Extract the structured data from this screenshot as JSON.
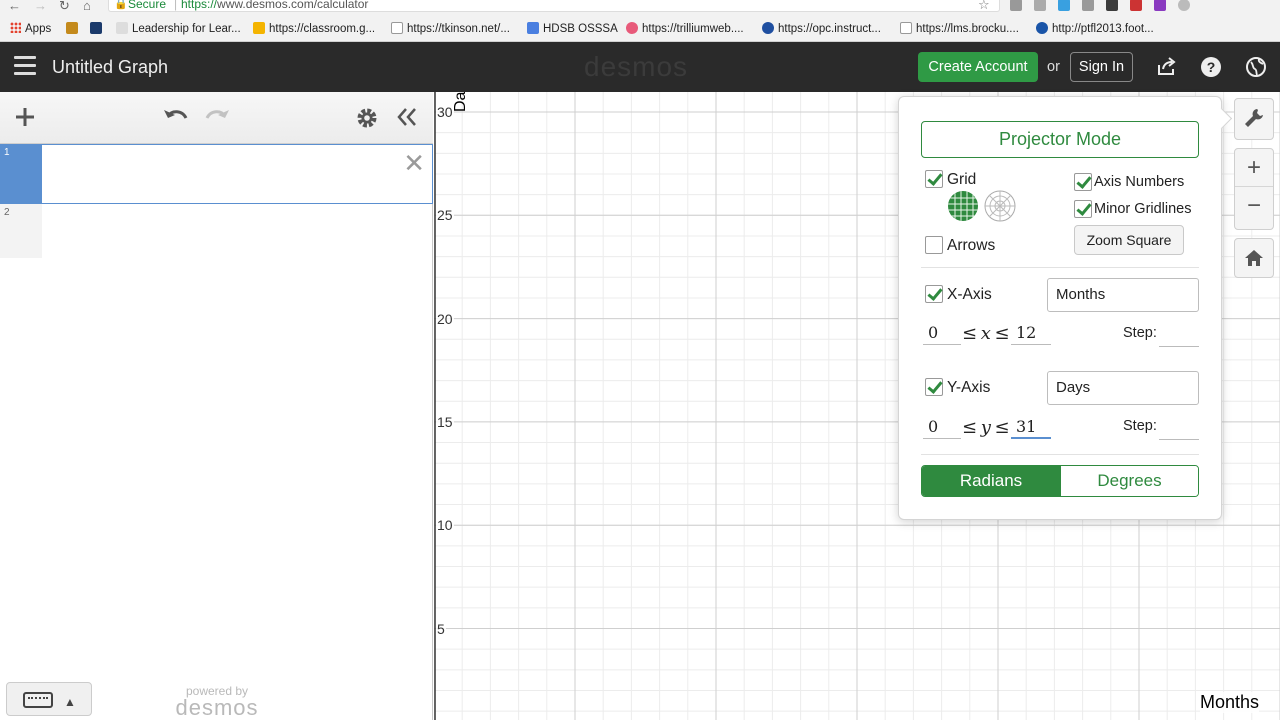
{
  "browser": {
    "secure_label": "Secure",
    "url_scheme": "https://",
    "url_rest": "www.desmos.com/calculator",
    "bookmarks": [
      {
        "label": "Apps"
      },
      {
        "label": ""
      },
      {
        "label": ""
      },
      {
        "label": "Leadership for Lear..."
      },
      {
        "label": "https://classroom.g..."
      },
      {
        "label": "https://tkinson.net/..."
      },
      {
        "label": "HDSB OSSSA"
      },
      {
        "label": "https://trilliumweb...."
      },
      {
        "label": "https://opc.instruct..."
      },
      {
        "label": "https://lms.brocku...."
      },
      {
        "label": "http://ptfl2013.foot..."
      }
    ]
  },
  "header": {
    "title": "Untitled Graph",
    "brand": "desmos",
    "create_account": "Create Account",
    "or": "or",
    "sign_in": "Sign In",
    "icons": [
      "share-icon",
      "help-icon",
      "language-icon"
    ]
  },
  "expressions": {
    "toolbar_icons": [
      "add-icon",
      "undo-icon",
      "redo-icon",
      "settings-icon",
      "collapse-icon"
    ],
    "rows": [
      {
        "index": "1",
        "value": ""
      },
      {
        "index": "2",
        "value": ""
      }
    ],
    "powered_by": "powered by",
    "powered_brand": "desmos"
  },
  "graph": {
    "y_ticks": [
      "30",
      "25",
      "20",
      "15",
      "10",
      "5"
    ],
    "y_axis_label": "Days",
    "x_axis_label": "Months",
    "xlim": [
      0,
      12
    ],
    "ylim": [
      0,
      31
    ]
  },
  "graph_controls": [
    "wrench-icon",
    "zoom-in-icon",
    "zoom-out-icon",
    "home-icon"
  ],
  "settings": {
    "projector_mode": "Projector Mode",
    "grid": {
      "label": "Grid",
      "checked": true
    },
    "axis_numbers": {
      "label": "Axis Numbers",
      "checked": true
    },
    "minor_gridlines": {
      "label": "Minor Gridlines",
      "checked": true
    },
    "arrows": {
      "label": "Arrows",
      "checked": false
    },
    "zoom_square": "Zoom Square",
    "x_axis": {
      "label": "X-Axis",
      "checked": true,
      "title": "Months",
      "min": "0",
      "var": "x",
      "max": "12",
      "step_label": "Step:",
      "step": ""
    },
    "y_axis": {
      "label": "Y-Axis",
      "checked": true,
      "title": "Days",
      "min": "0",
      "var": "y",
      "max": "31",
      "step_label": "Step:",
      "step": ""
    },
    "angle_modes": [
      "Radians",
      "Degrees"
    ],
    "selected_angle_mode": "Radians",
    "accent_color": "#2f8a3f"
  }
}
